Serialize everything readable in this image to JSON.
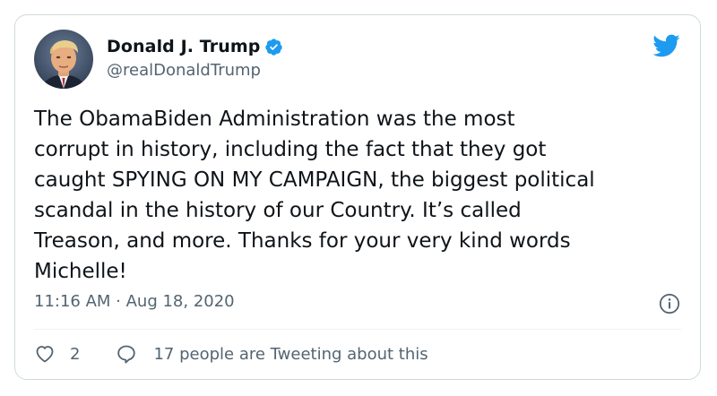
{
  "author": {
    "display_name": "Donald J. Trump",
    "handle": "@realDonaldTrump",
    "verified": true,
    "avatar_icon": "profile-photo"
  },
  "tweet": {
    "text": "The ObamaBiden Administration was the most\ncorrupt in history, including the fact that they got\ncaught SPYING ON MY CAMPAIGN, the biggest political\nscandal in the history of our Country. It’s called\nTreason, and more. Thanks for your very kind words\nMichelle!",
    "timestamp": "11:16 AM · Aug 18, 2020"
  },
  "actions": {
    "like_count": "2",
    "tweeting_about": "17 people are Tweeting about this"
  },
  "icons": {
    "brand": "twitter-bird-icon",
    "verified": "verified-badge-icon",
    "info": "info-icon",
    "like": "heart-icon",
    "reply": "speech-bubble-icon"
  },
  "colors": {
    "brand": "#1d9bf0",
    "text": "#0f1419",
    "secondary": "#536471",
    "border": "#cfd9de"
  }
}
